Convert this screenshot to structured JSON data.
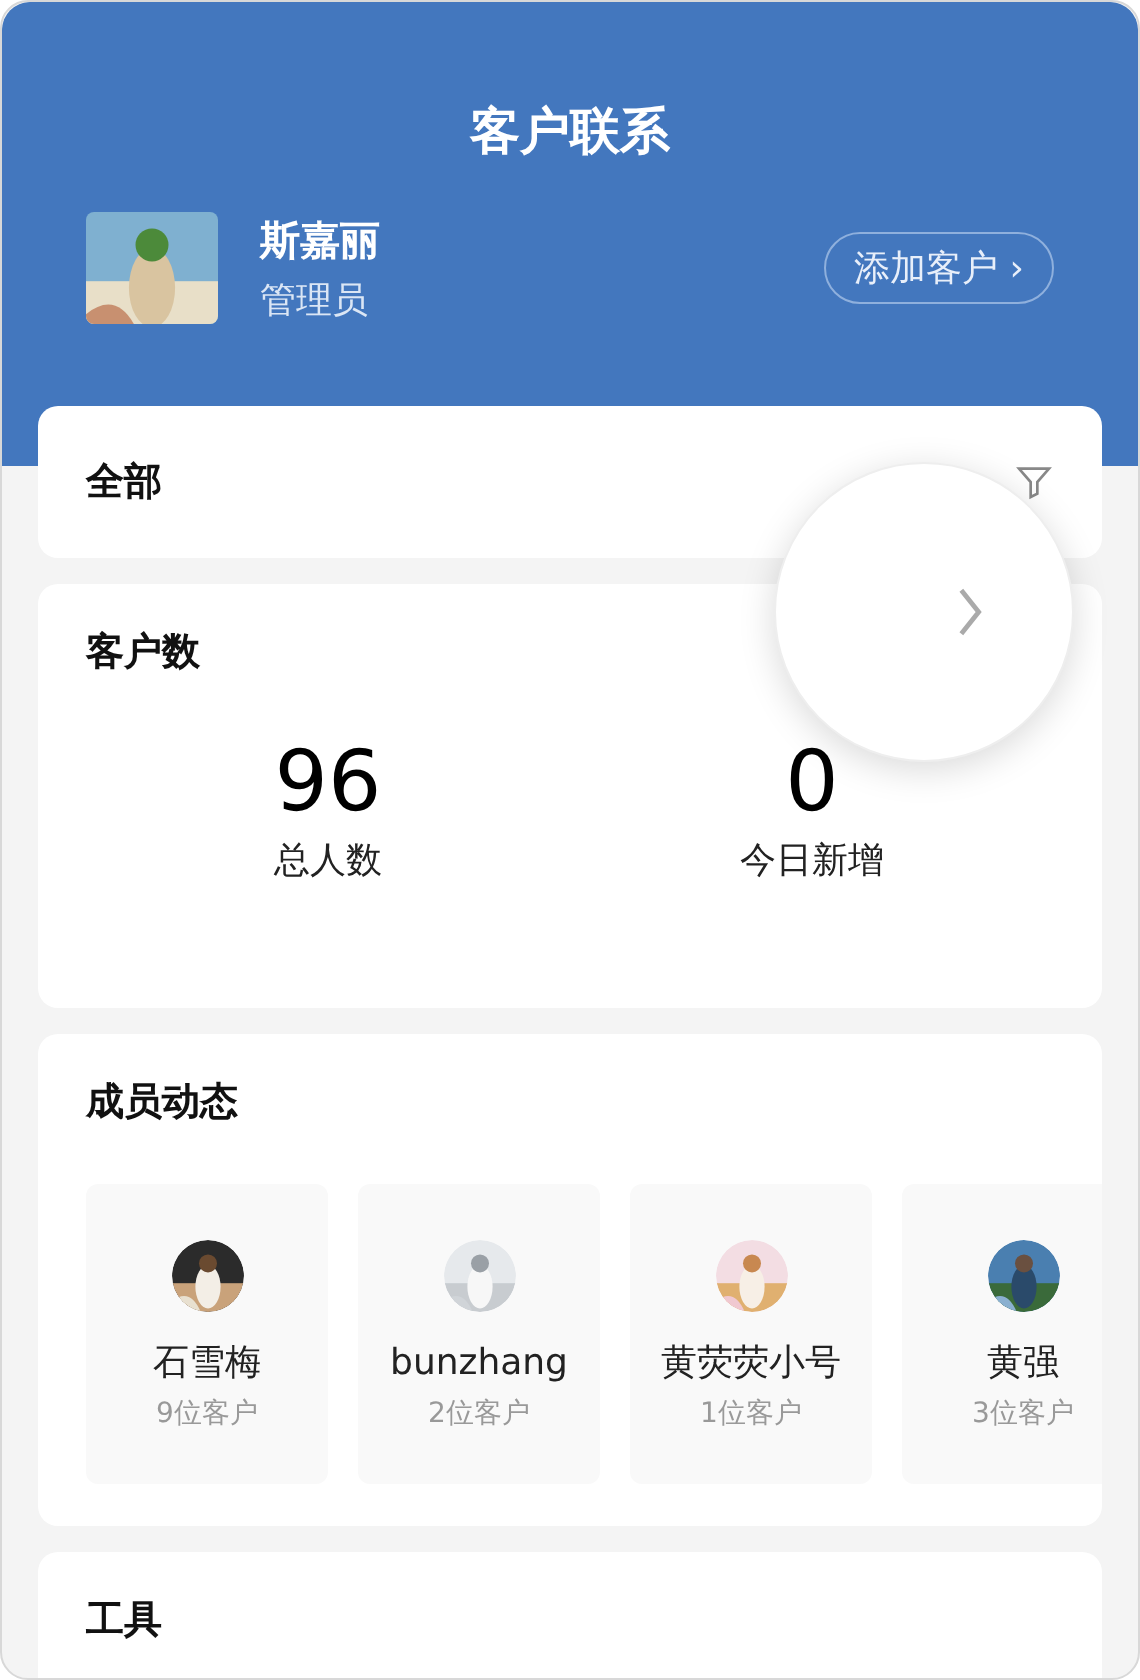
{
  "header": {
    "title": "客户联系",
    "user": {
      "name": "斯嘉丽",
      "role": "管理员"
    },
    "add_button": {
      "label": "添加客户",
      "arrow": "›"
    }
  },
  "filter": {
    "label": "全部"
  },
  "customer_count": {
    "title": "客户数",
    "stats": [
      {
        "value": "96",
        "label": "总人数"
      },
      {
        "value": "0",
        "label": "今日新增"
      }
    ]
  },
  "members": {
    "title": "成员动态",
    "items": [
      {
        "name": "石雪梅",
        "count": "9位客户"
      },
      {
        "name": "bunzhang",
        "count": "2位客户"
      },
      {
        "name": "黄荧荧小号",
        "count": "1位客户"
      },
      {
        "name": "黄强",
        "count": "3位客户"
      }
    ]
  },
  "tools": {
    "title": "工具"
  }
}
